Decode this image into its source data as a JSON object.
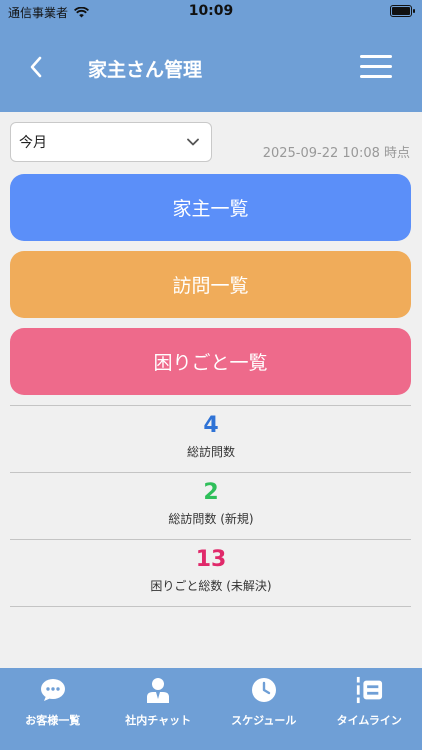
{
  "status_bar": {
    "carrier": "通信事業者",
    "time": "10:09"
  },
  "nav": {
    "title": "家主さん管理"
  },
  "filter": {
    "selected": "今月",
    "timestamp": "2025-09-22 10:08 時点"
  },
  "buttons": [
    {
      "label": "家主一覧",
      "color": "#5b8ff9"
    },
    {
      "label": "訪問一覧",
      "color": "#f0ac5a"
    },
    {
      "label": "困りごと一覧",
      "color": "#ee6a8b"
    }
  ],
  "stats": [
    {
      "value": "4",
      "label": "総訪問数",
      "color": "#2f73d6"
    },
    {
      "value": "2",
      "label": "総訪問数 (新規)",
      "color": "#2fbf5a"
    },
    {
      "value": "13",
      "label": "困りごと総数 (未解決)",
      "color": "#e0296a"
    }
  ],
  "tabs": [
    {
      "label": "お客様一覧",
      "icon": "chat-bubble-icon"
    },
    {
      "label": "社内チャット",
      "icon": "person-icon"
    },
    {
      "label": "スケジュール",
      "icon": "clock-icon"
    },
    {
      "label": "タイムライン",
      "icon": "timeline-icon"
    }
  ]
}
